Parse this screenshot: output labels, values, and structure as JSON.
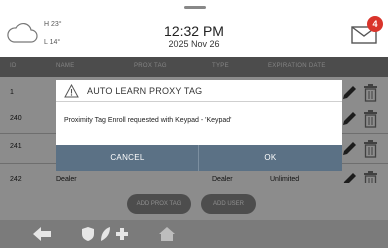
{
  "header": {
    "temp_high": "H 23°",
    "temp_low": "L 14°",
    "time": "12:32 PM",
    "date": "2025 Nov 26",
    "unread_count": "4",
    "badge_color": "#d9342b"
  },
  "table": {
    "columns": [
      "ID",
      "NAME",
      "PROX TAG",
      "TYPE",
      "EXPIRATION DATE"
    ],
    "rows": [
      {
        "id": "1",
        "name": "",
        "prox_tag": "",
        "type": "",
        "expiration": ""
      },
      {
        "id": "240",
        "name": "",
        "prox_tag": "",
        "type": "",
        "expiration": ""
      },
      {
        "id": "241",
        "name": "",
        "prox_tag": "",
        "type": "",
        "expiration": ""
      },
      {
        "id": "242",
        "name": "Dealer",
        "prox_tag": "",
        "type": "Dealer",
        "expiration": "Unlimited"
      }
    ]
  },
  "actions": {
    "add_prox_tag": "ADD PROX TAG",
    "add_user": "ADD USER"
  },
  "dialog": {
    "title": "AUTO LEARN PROXY TAG",
    "message": "Proximity Tag Enroll requested with Keypad - 'Keypad'",
    "cancel_label": "CANCEL",
    "ok_label": "OK",
    "button_bar_color": "#5b7185"
  },
  "icons": {
    "weather": "cloud-icon",
    "mail": "envelope-icon",
    "edit": "pencil-icon",
    "delete": "trash-icon",
    "warning": "warning-triangle-icon",
    "back": "back-arrow-icon",
    "security": "shield-icon",
    "smart_home": "leaf-icon",
    "add": "plus-icon",
    "home": "home-icon"
  }
}
